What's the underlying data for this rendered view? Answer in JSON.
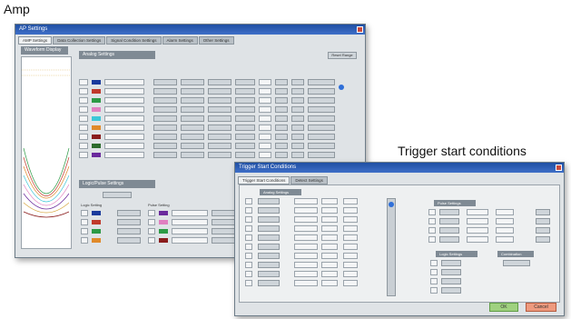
{
  "captions": {
    "amp": "Amp",
    "trigger": "Trigger start conditions"
  },
  "amp_window": {
    "title": "AP Settings",
    "tabs": [
      "AMP Settings",
      "Data Collection Settings",
      "Signal Condition Settings",
      "Alarm Settings",
      "Other Settings"
    ],
    "waveform_panel_title": "Waveform Display",
    "analog_panel_title": "Analog Settings",
    "logic_panel_title": "Logic/Pulse Settings",
    "reset_button": "Reset Range",
    "logic_row_labels": [
      "Logic Setting",
      "Pulse Setting"
    ],
    "channel_colors": [
      "#1a3a9c",
      "#c0392b",
      "#2c9a45",
      "#e07fc0",
      "#3cc7d8",
      "#e08a2a",
      "#8a1c1c",
      "#2c6b2c",
      "#6a2a9c"
    ],
    "logic_colors": [
      "#1a3a9c",
      "#c0392b",
      "#2c9a45",
      "#e08a2a"
    ],
    "pulse_colors": [
      "#6a2a9c",
      "#e07fc0",
      "#2c9a45",
      "#8a1c1c"
    ]
  },
  "trigger_window": {
    "title": "Trigger Start Conditions",
    "tabs": [
      "Trigger Start Conditions",
      "Detect Settings"
    ],
    "analog_section": "Analog Settings",
    "pulse_section": "Pulse Settings",
    "logic_section": "Logic Settings",
    "combination_section": "Combination",
    "ok_label": "OK",
    "cancel_label": "Cancel"
  },
  "colors": {
    "titlebar": "#1f4fa3",
    "panel_head": "#7f8a94",
    "ok": "#9fd17f",
    "cancel": "#ee9a7e"
  }
}
